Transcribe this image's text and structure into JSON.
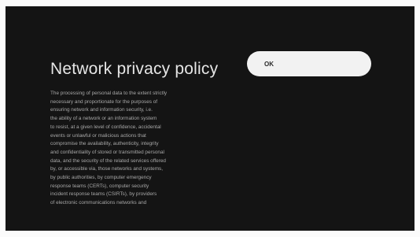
{
  "dialog": {
    "title": "Network privacy policy",
    "policy_lines": [
      "The processing of personal data to the extent strictly",
      "necessary and proportionate for the purposes of",
      "ensuring network and information security, i.e.",
      "the ability of a network or an information system",
      "to resist, at a given level of confidence, accidental",
      "events or unlawful or malicious actions that",
      "compromise the availability, authenticity, integrity",
      "and confidentiality of stored or transmitted personal",
      "data, and the security of the related services offered",
      "by, or accessible via, those networks and systems,",
      "by public authorities, by computer emergency",
      "response teams (CERTs), computer security",
      "incident response teams (CSIRTs), by providers",
      "of electronic communications networks and"
    ],
    "ok_label": "OK"
  }
}
